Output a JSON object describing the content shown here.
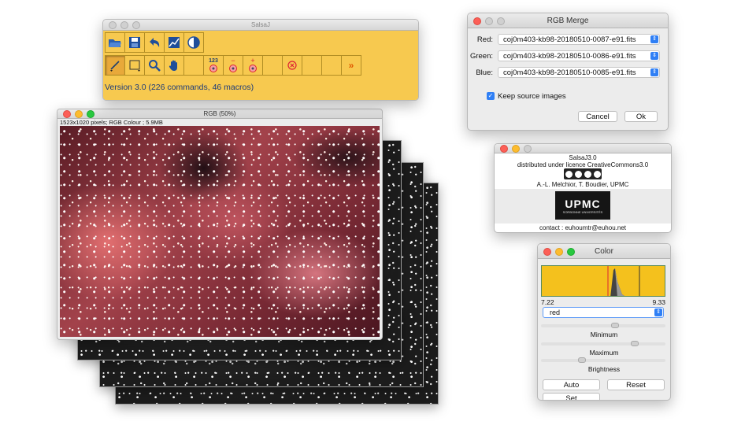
{
  "salsaj": {
    "title": "SalsaJ",
    "version": "Version 3.0 (226 commands, 46 macros)",
    "row1_icons": [
      "open-folder-icon",
      "save-icon",
      "undo-icon",
      "plot-icon",
      "contrast-icon"
    ],
    "row2_icons": [
      "line-tool-icon",
      "rectangle-tool-icon",
      "magnifier-icon",
      "hand-icon",
      "",
      "counter-icon",
      "subtract-icon",
      "add-icon",
      "",
      "close-x-icon",
      "",
      "",
      "more-icon"
    ],
    "counter_text": "123",
    "more_text": "»"
  },
  "rgb_window": {
    "title": "RGB (50%)",
    "info": "1523x1020 pixels; RGB Colour ; 5.9MB"
  },
  "merge": {
    "title": "RGB Merge",
    "red_label": "Red:",
    "green_label": "Green:",
    "blue_label": "Blue:",
    "red_file": "coj0m403-kb98-20180510-0087-e91.fits",
    "green_file": "coj0m403-kb98-20180510-0086-e91.fits",
    "blue_file": "coj0m403-kb98-20180510-0085-e91.fits",
    "keep_label": "Keep source images",
    "cancel": "Cancel",
    "ok": "Ok"
  },
  "about": {
    "line1": "SalsaJ3.0",
    "line2": "distributed under licence CreativeCommons3.0",
    "line3": "A.-L. Melchior, T. Boudier, UPMC",
    "logo_text": "UPMC",
    "logo_sub": "SORBONNE UNIVERSITÉS",
    "contact": "contact : euhoumtr@euhou.net"
  },
  "color": {
    "title": "Color",
    "min_value": "7.22",
    "max_value": "9.33",
    "channel": "red",
    "minimum_label": "Minimum",
    "maximum_label": "Maximum",
    "brightness_label": "Brightness",
    "minimum_level": 0.6,
    "maximum_level": 0.77,
    "brightness_level": 0.32,
    "auto": "Auto",
    "reset": "Reset",
    "set": "Set",
    "histogram_color": "#f4c11d"
  }
}
